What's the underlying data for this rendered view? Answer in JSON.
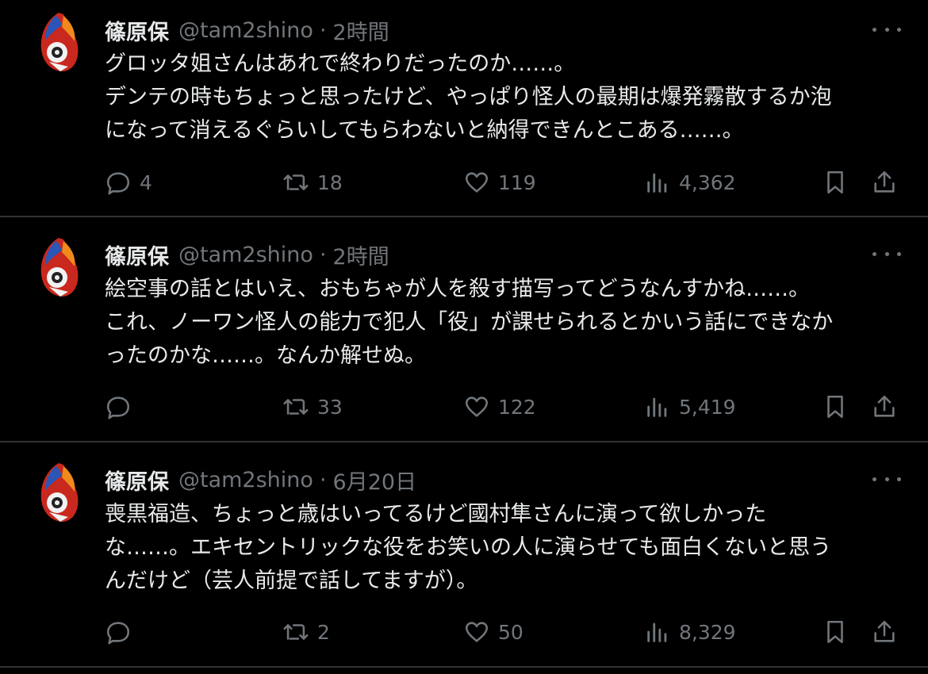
{
  "tweets": [
    {
      "name": "篠原保",
      "handle": "@tam2shino",
      "dot": "·",
      "time": "2時間",
      "lines": [
        "グロッタ姐さんはあれで終わりだったのか……。",
        "デンテの時もちょっと思ったけど、やっぱり怪人の最期は爆発霧散するか泡",
        "になって消えるぐらいしてもらわないと納得できんとこある……。"
      ],
      "replies": "4",
      "retweets": "18",
      "likes": "119",
      "views": "4,362"
    },
    {
      "name": "篠原保",
      "handle": "@tam2shino",
      "dot": "·",
      "time": "2時間",
      "lines": [
        "絵空事の話とはいえ、おもちゃが人を殺す描写ってどうなんすかね……。",
        "これ、ノーワン怪人の能力で犯人「役」が課せられるとかいう話にできなか",
        "ったのかな……。なんか解せぬ。"
      ],
      "replies": "",
      "retweets": "33",
      "likes": "122",
      "views": "5,419"
    },
    {
      "name": "篠原保",
      "handle": "@tam2shino",
      "dot": "·",
      "time": "6月20日",
      "lines": [
        "喪黒福造、ちょっと歳はいってるけど國村隼さんに演って欲しかった",
        "な……。エキセントリックな役をお笑いの人に演らせても面白くないと思う",
        "んだけど（芸人前提で話してますが）。"
      ],
      "replies": "",
      "retweets": "2",
      "likes": "50",
      "views": "8,329"
    }
  ],
  "colors": {
    "background": "#000000",
    "text": "#e7e9ea",
    "secondary": "#71767b",
    "divider": "#2f3336"
  },
  "icons": [
    "reply-icon",
    "retweet-icon",
    "like-icon",
    "views-icon",
    "bookmark-icon",
    "share-icon",
    "more-icon"
  ]
}
